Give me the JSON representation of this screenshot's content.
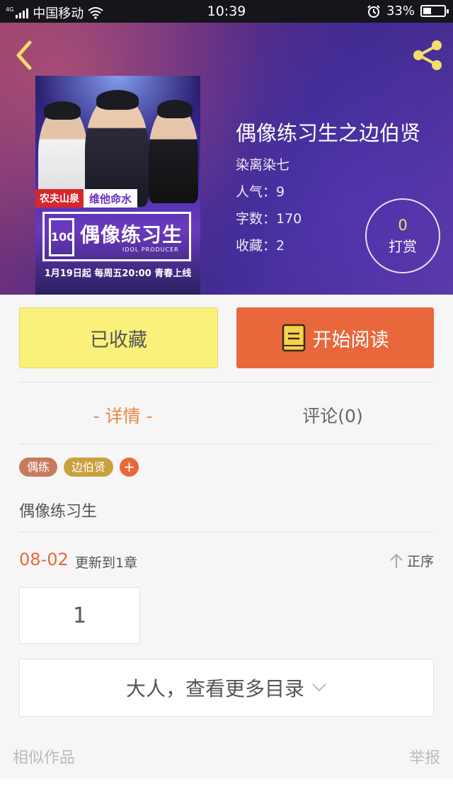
{
  "status_bar": {
    "network": "4G",
    "carrier": "中国移动",
    "time": "10:39",
    "battery_percent": "33%",
    "battery_level": 0.33
  },
  "header": {
    "title": "偶像练习生之边伯贤",
    "author": "染离染七",
    "popularity": "人气：9",
    "word_count": "字数：170",
    "favorites": "收藏：2",
    "tip_count": "0",
    "tip_label": "打赏",
    "icons": {
      "back": "back-arrow-icon",
      "share": "share-icon"
    },
    "accent_color": "#f3dd6e"
  },
  "cover": {
    "sponsor_brand": "农夫山泉",
    "sponsor_slogan": "维他命水",
    "logo_number": "100",
    "logo_title": "偶像练习生",
    "logo_subtitle": "IDOL PRODUCER",
    "air_info": "1月19日起  每周五20:00  青春上线"
  },
  "actions": {
    "favorite_label": "已收藏",
    "read_label": "开始阅读",
    "favorite_color": "#faf17b",
    "read_color": "#e8683b"
  },
  "tabs": [
    {
      "label": "- 详情 -",
      "active": true
    },
    {
      "label": "评论(0)",
      "active": false
    }
  ],
  "tags": [
    {
      "label": "偶练",
      "color": "#c87a5e"
    },
    {
      "label": "边伯贤",
      "color": "#c9a03a"
    }
  ],
  "tag_add": "+",
  "description": "偶像练习生",
  "update": {
    "date": "08-02",
    "text": "更新到1章",
    "sort_label": "正序"
  },
  "chapters": [
    "1"
  ],
  "more_catalog": "大人，查看更多目录",
  "footer": {
    "similar": "相似作品",
    "report": "举报"
  }
}
